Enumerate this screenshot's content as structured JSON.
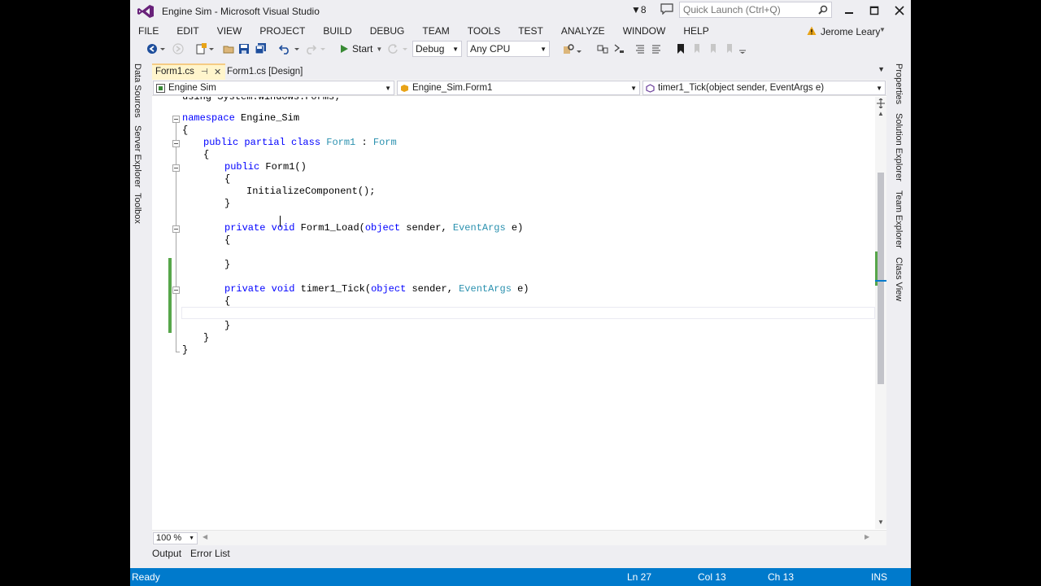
{
  "window": {
    "title": "Engine Sim - Microsoft Visual Studio",
    "notifications_count": "8",
    "quick_launch_placeholder": "Quick Launch (Ctrl+Q)",
    "account_name": "Jerome Leary"
  },
  "menu": [
    "FILE",
    "EDIT",
    "VIEW",
    "PROJECT",
    "BUILD",
    "DEBUG",
    "TEAM",
    "TOOLS",
    "TEST",
    "ANALYZE",
    "WINDOW",
    "HELP"
  ],
  "toolbar": {
    "start_label": "Start",
    "configuration": "Debug",
    "platform": "Any CPU"
  },
  "left_dock": [
    "Data Sources",
    "Server Explorer",
    "Toolbox"
  ],
  "right_dock": [
    "Properties",
    "Solution Explorer",
    "Team Explorer",
    "Class View"
  ],
  "editor": {
    "tabs": [
      {
        "label": "Form1.cs",
        "active": true
      },
      {
        "label": "Form1.cs [Design]",
        "active": false
      }
    ],
    "nav": {
      "project": "Engine Sim",
      "type": "Engine_Sim.Form1",
      "member": "timer1_Tick(object sender, EventArgs e)"
    },
    "code": {
      "top_partial": "using System.Windows.Forms;",
      "namespace_kw": "namespace",
      "namespace_name": " Engine_Sim",
      "open_ns": "{",
      "class_public": "public",
      "class_partial": " partial",
      "class_kw": " class",
      "class_name": "Form1",
      "class_colon": " : ",
      "class_base": "Form",
      "open_class": "{",
      "ctor_public": "public",
      "ctor_name": " Form1()",
      "open_ctor": "{",
      "ctor_body": "InitializeComponent();",
      "close_ctor": "}",
      "load_private": "private",
      "load_void": " void",
      "load_sig1": " Form1_Load(",
      "load_obj": "object",
      "load_sig2": " sender, ",
      "load_eventargs": "EventArgs",
      "load_sig3": " e)",
      "open_load": "{",
      "close_load": "}",
      "tick_private": "private",
      "tick_void": " void",
      "tick_sig1": " timer1_Tick(",
      "tick_obj": "object",
      "tick_sig2": " sender, ",
      "tick_eventargs": "EventArgs",
      "tick_sig3": " e)",
      "open_tick": "{",
      "close_tick": "}",
      "close_class": "}",
      "close_ns": "}"
    },
    "zoom": "100 %"
  },
  "bottom_tabs": [
    "Output",
    "Error List"
  ],
  "status": {
    "message": "Ready",
    "line": "Ln 27",
    "col": "Col 13",
    "ch": "Ch 13",
    "mode": "INS"
  },
  "colors": {
    "accent": "#007acc",
    "keyword": "#0000ff",
    "type": "#2b91af",
    "change_bar": "#57a64a",
    "vs_purple": "#68217a"
  }
}
